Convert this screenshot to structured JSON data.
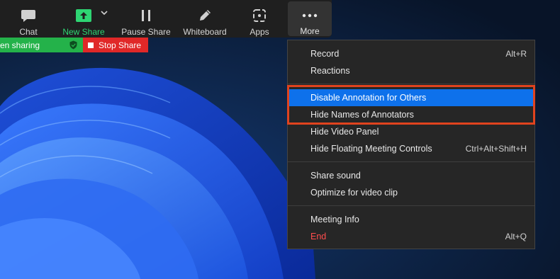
{
  "toolbar": {
    "chat": {
      "label": "Chat",
      "icon": "chat-icon"
    },
    "new_share": {
      "label": "New Share",
      "icon": "share-arrow-icon",
      "color": "#2ed573"
    },
    "pause_share": {
      "label": "Pause Share",
      "icon": "pause-icon"
    },
    "whiteboard": {
      "label": "Whiteboard",
      "icon": "pencil-icon"
    },
    "apps": {
      "label": "Apps",
      "icon": "apps-icon"
    },
    "more": {
      "label": "More",
      "icon": "ellipsis-icon"
    }
  },
  "share_bar": {
    "status": "en sharing",
    "stop_label": "Stop Share",
    "status_color": "#24b24a",
    "stop_color": "#e02828"
  },
  "menu": {
    "items": [
      {
        "label": "Record",
        "shortcut": "Alt+R"
      },
      {
        "label": "Reactions",
        "shortcut": ""
      },
      {
        "label": "Disable Annotation for Others",
        "shortcut": "",
        "selected": true
      },
      {
        "label": "Hide Names of Annotators",
        "shortcut": ""
      },
      {
        "label": "Hide Video Panel",
        "shortcut": ""
      },
      {
        "label": "Hide Floating Meeting Controls",
        "shortcut": "Ctrl+Alt+Shift+H"
      },
      {
        "label": "Share sound",
        "shortcut": ""
      },
      {
        "label": "Optimize for video clip",
        "shortcut": ""
      },
      {
        "label": "Meeting Info",
        "shortcut": ""
      },
      {
        "label": "End",
        "shortcut": "Alt+Q",
        "danger": true
      }
    ],
    "selected_color": "#0e71eb",
    "highlight_color": "#e0431e"
  }
}
